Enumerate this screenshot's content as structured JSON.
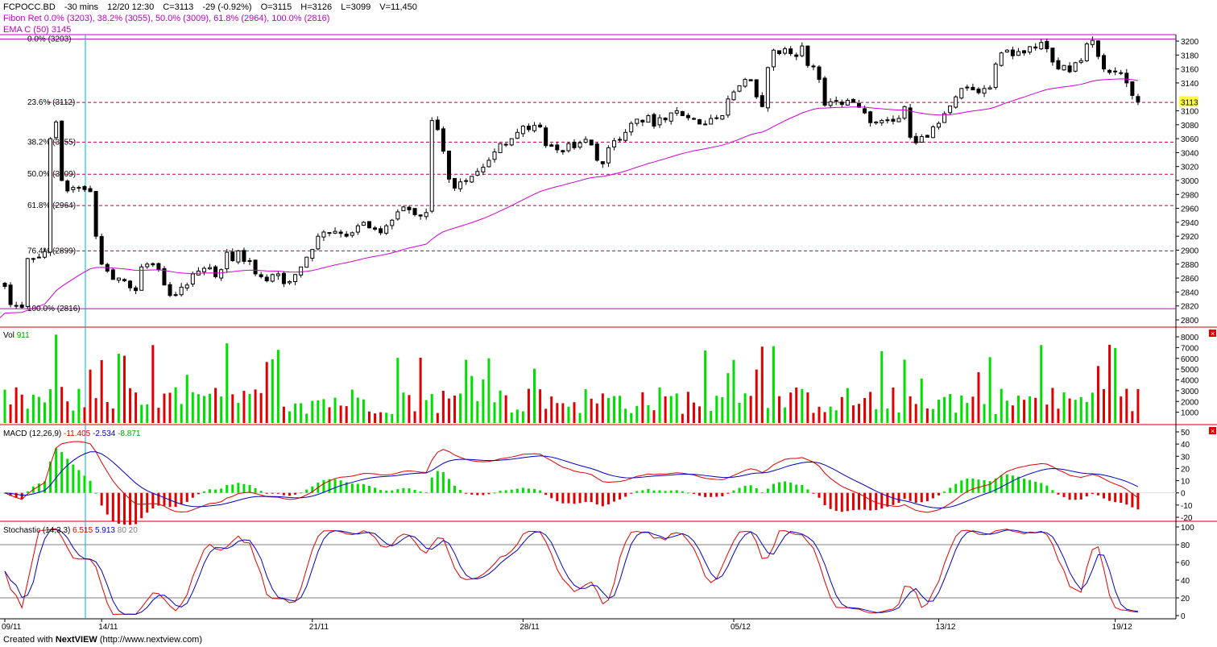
{
  "header": {
    "symbol": "FCPOCC.BD",
    "interval": "-30 mins",
    "datetime": "12/20 12:30",
    "close": "C=3113",
    "change": "-29 (-0.92%)",
    "open": "O=3115",
    "high": "H=3126",
    "low": "L=3099",
    "volume": "V=11,450",
    "fibon": "Fibon Ret 0.0% (3203), 38.2% (3055), 50.0% (3009), 61.8% (2964), 100.0% (2816)",
    "ema": "EMA C (50) 3145"
  },
  "colors": {
    "up": "#00e000",
    "down": "#e00000",
    "ema": "#d000d0",
    "fib": "#b00050",
    "cursor": "#00b0e0",
    "macd": "#0000c0",
    "signal": "#e00000",
    "stochK": "#e00000",
    "stochD": "#0000c0",
    "axis": "#000000",
    "divider": "#c00000"
  },
  "fib_levels": [
    {
      "label": "0.0% (3203)",
      "price": 3203
    },
    {
      "label": "23.6% (3112)",
      "price": 3112
    },
    {
      "label": "38.2% (3055)",
      "price": 3055
    },
    {
      "label": "50.0% (3009)",
      "price": 3009
    },
    {
      "label": "61.8% (2964)",
      "price": 2964
    },
    {
      "label": "76.4% (2899)",
      "price": 2899
    },
    {
      "label": "100.0% (2816)",
      "price": 2816
    }
  ],
  "last_price_tag": "3113",
  "panels": {
    "vol": {
      "label": "Vol",
      "value": "911"
    },
    "macd": {
      "label": "MACD (12,26,9)",
      "v1": "-11.405",
      "v2": "-2.534",
      "v3": "-8.871"
    },
    "stoch": {
      "label": "Stochastic (14,3,3)",
      "v1": "6.515",
      "v2": "5.913",
      "v3": "80 20"
    }
  },
  "footer": {
    "prefix": "Created with",
    "brand1": "Next",
    "brand2": "VIEW",
    "url": "(http://www.nextview.com)"
  },
  "chart_data": {
    "type": "candlestick",
    "x_labels": [
      {
        "label": "09/11",
        "bar": 0
      },
      {
        "label": "14/11",
        "bar": 17
      },
      {
        "label": "21/11",
        "bar": 54
      },
      {
        "label": "28/11",
        "bar": 91
      },
      {
        "label": "05/12",
        "bar": 128
      },
      {
        "label": "13/12",
        "bar": 164
      },
      {
        "label": "19/12",
        "bar": 195
      }
    ],
    "price_axis": {
      "min": 2800,
      "max": 3200,
      "ticks": [
        2800,
        2820,
        2840,
        2860,
        2880,
        2900,
        2920,
        2940,
        2960,
        2980,
        3000,
        3020,
        3040,
        3060,
        3080,
        3100,
        3120,
        3140,
        3160,
        3180,
        3200
      ]
    },
    "vol_axis": {
      "min": 0,
      "max": 8000,
      "ticks": [
        1000,
        2000,
        3000,
        4000,
        5000,
        6000,
        7000,
        8000
      ]
    },
    "macd_axis": {
      "min": -20,
      "max": 50,
      "ticks": [
        -20,
        -10,
        0,
        10,
        20,
        30,
        40,
        50
      ]
    },
    "stoch_axis": {
      "min": 0,
      "max": 100,
      "ticks": [
        0,
        20,
        40,
        60,
        80,
        100
      ],
      "levels": [
        20,
        80
      ]
    },
    "close": [
      2848,
      2822,
      2820,
      2818,
      2888,
      2888,
      2890,
      2898,
      3060,
      3084,
      3000,
      2985,
      2990,
      2990,
      2987,
      2984,
      2920,
      2880,
      2870,
      2858,
      2860,
      2856,
      2846,
      2842,
      2876,
      2880,
      2879,
      2872,
      2850,
      2835,
      2835,
      2847,
      2850,
      2866,
      2870,
      2874,
      2875,
      2862,
      2872,
      2897,
      2885,
      2899,
      2884,
      2885,
      2866,
      2862,
      2856,
      2865,
      2866,
      2852,
      2855,
      2865,
      2876,
      2890,
      2901,
      2920,
      2926,
      2925,
      2927,
      2924,
      2920,
      2925,
      2935,
      2940,
      2932,
      2930,
      2925,
      2935,
      2943,
      2955,
      2962,
      2958,
      2951,
      2949,
      2954,
      3086,
      3073,
      3042,
      3002,
      2989,
      2998,
      2999,
      3006,
      3013,
      3019,
      3029,
      3041,
      3053,
      3051,
      3060,
      3069,
      3078,
      3073,
      3079,
      3077,
      3050,
      3049,
      3044,
      3041,
      3053,
      3047,
      3054,
      3059,
      3051,
      3029,
      3024,
      3047,
      3057,
      3059,
      3069,
      3082,
      3088,
      3084,
      3093,
      3078,
      3090,
      3087,
      3097,
      3100,
      3093,
      3090,
      3089,
      3081,
      3081,
      3089,
      3090,
      3093,
      3117,
      3127,
      3136,
      3145,
      3143,
      3120,
      3106,
      3162,
      3187,
      3182,
      3189,
      3182,
      3178,
      3193,
      3165,
      3163,
      3145,
      3108,
      3113,
      3114,
      3109,
      3115,
      3112,
      3105,
      3097,
      3083,
      3084,
      3086,
      3087,
      3085,
      3089,
      3106,
      3062,
      3054,
      3063,
      3062,
      3077,
      3082,
      3096,
      3107,
      3120,
      3132,
      3134,
      3130,
      3126,
      3132,
      3133,
      3167,
      3183,
      3187,
      3179,
      3185,
      3183,
      3192,
      3190,
      3198,
      3189,
      3170,
      3160,
      3165,
      3156,
      3169,
      3172,
      3196,
      3201,
      3178,
      3160,
      3155,
      3156,
      3154,
      3140,
      3122,
      3113
    ]
  }
}
